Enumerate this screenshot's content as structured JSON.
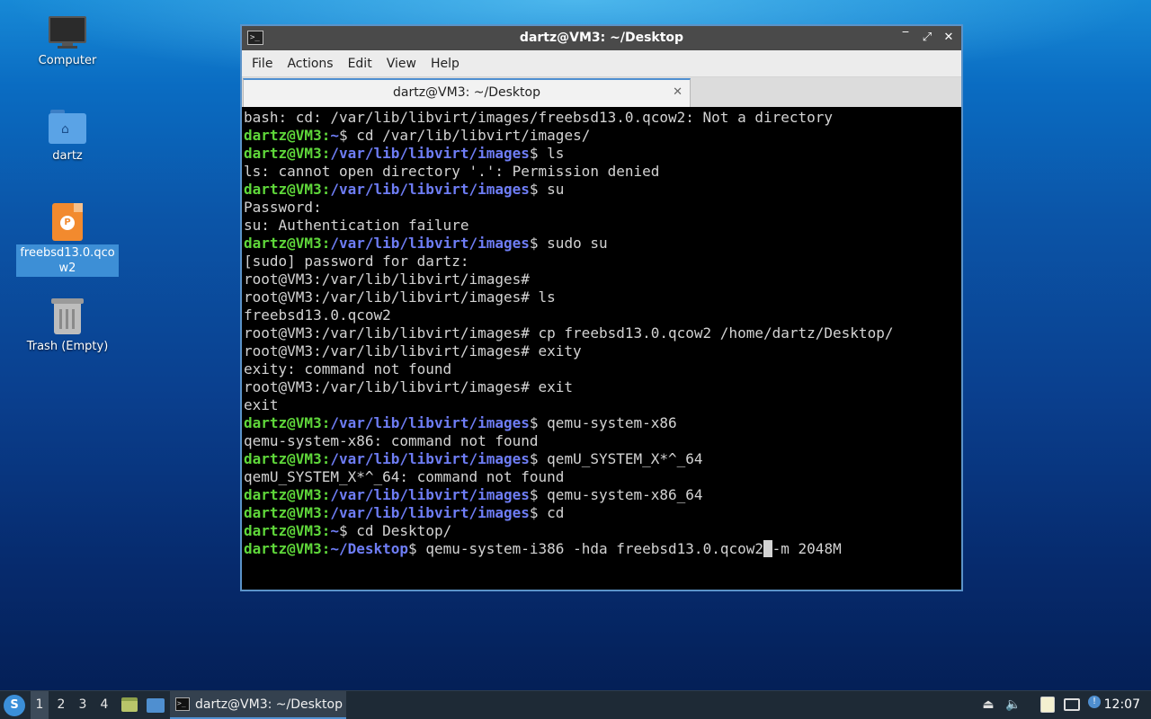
{
  "desktop": {
    "icons": [
      {
        "label": "Computer"
      },
      {
        "label": "dartz"
      },
      {
        "label": "freebsd13.0.qcow2"
      },
      {
        "label": "Trash (Empty)"
      }
    ]
  },
  "window": {
    "title": "dartz@VM3: ~/Desktop",
    "menu": [
      "File",
      "Actions",
      "Edit",
      "View",
      "Help"
    ],
    "tab_label": "dartz@VM3: ~/Desktop",
    "controls": {
      "minimize": "‾",
      "maximize": "⤢",
      "close": "✕"
    }
  },
  "terminal": {
    "colors": {
      "user_host": "#5fd73a",
      "path": "#6e7df5",
      "text": "#d3d3d3",
      "background": "#000000"
    },
    "lines": [
      {
        "type": "out",
        "text": "bash: cd: /var/lib/libvirt/images/freebsd13.0.qcow2: Not a directory"
      },
      {
        "type": "prompt",
        "user": "dartz@VM3",
        "path": "~",
        "cmd": "cd /var/lib/libvirt/images/"
      },
      {
        "type": "prompt",
        "user": "dartz@VM3",
        "path": "/var/lib/libvirt/images",
        "cmd": "ls"
      },
      {
        "type": "out",
        "text": "ls: cannot open directory '.': Permission denied"
      },
      {
        "type": "prompt",
        "user": "dartz@VM3",
        "path": "/var/lib/libvirt/images",
        "cmd": "su"
      },
      {
        "type": "out",
        "text": "Password:"
      },
      {
        "type": "out",
        "text": "su: Authentication failure"
      },
      {
        "type": "prompt",
        "user": "dartz@VM3",
        "path": "/var/lib/libvirt/images",
        "cmd": "sudo su"
      },
      {
        "type": "out",
        "text": "[sudo] password for dartz:"
      },
      {
        "type": "out",
        "text": "root@VM3:/var/lib/libvirt/images#"
      },
      {
        "type": "out",
        "text": "root@VM3:/var/lib/libvirt/images# ls"
      },
      {
        "type": "out",
        "text": "freebsd13.0.qcow2"
      },
      {
        "type": "out",
        "text": "root@VM3:/var/lib/libvirt/images# cp freebsd13.0.qcow2 /home/dartz/Desktop/"
      },
      {
        "type": "out",
        "text": "root@VM3:/var/lib/libvirt/images# exity"
      },
      {
        "type": "out",
        "text": "exity: command not found"
      },
      {
        "type": "out",
        "text": "root@VM3:/var/lib/libvirt/images# exit"
      },
      {
        "type": "out",
        "text": "exit"
      },
      {
        "type": "prompt",
        "user": "dartz@VM3",
        "path": "/var/lib/libvirt/images",
        "cmd": "qemu-system-x86"
      },
      {
        "type": "out",
        "text": "qemu-system-x86: command not found"
      },
      {
        "type": "prompt",
        "user": "dartz@VM3",
        "path": "/var/lib/libvirt/images",
        "cmd": "qemU_SYSTEM_X*^_64"
      },
      {
        "type": "out",
        "text": "qemU_SYSTEM_X*^_64: command not found"
      },
      {
        "type": "prompt",
        "user": "dartz@VM3",
        "path": "/var/lib/libvirt/images",
        "cmd": "qemu-system-x86_64"
      },
      {
        "type": "prompt",
        "user": "dartz@VM3",
        "path": "/var/lib/libvirt/images",
        "cmd": "cd"
      },
      {
        "type": "prompt",
        "user": "dartz@VM3",
        "path": "~",
        "cmd": "cd Desktop/"
      },
      {
        "type": "prompt",
        "user": "dartz@VM3",
        "path": "~/Desktop",
        "cmd": "qemu-system-i386 -hda freebsd13.0.qcow2",
        "cursor": " ",
        "after": "-m 2048M"
      }
    ]
  },
  "taskbar": {
    "workspaces": [
      "1",
      "2",
      "3",
      "4"
    ],
    "active_workspace": "1",
    "task_label": "dartz@VM3: ~/Desktop",
    "clock": "12:07",
    "tray_icons": [
      "eject-icon",
      "volume-icon",
      "clipboard-icon",
      "network-icon",
      "update-notifier-icon"
    ]
  }
}
